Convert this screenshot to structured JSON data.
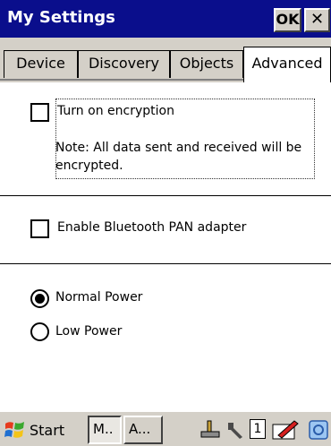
{
  "window": {
    "title": "My Settings",
    "ok_label": "OK",
    "close_label": "✕"
  },
  "tabs": [
    {
      "label": "Device",
      "active": false
    },
    {
      "label": "Discovery",
      "active": false
    },
    {
      "label": "Objects",
      "active": false
    },
    {
      "label": "Advanced",
      "active": true
    }
  ],
  "encryption": {
    "label": "Turn on encryption",
    "checked": false,
    "note": "Note: All data sent and received will be encrypted."
  },
  "pan_adapter": {
    "label": "Enable Bluetooth PAN adapter",
    "checked": false
  },
  "power": {
    "options": [
      {
        "label": "Normal Power",
        "selected": true
      },
      {
        "label": "Low Power",
        "selected": false
      }
    ]
  },
  "taskbar": {
    "start_label": "Start",
    "tasks": [
      "M..",
      "A..."
    ],
    "tray_number": "1",
    "icons": [
      "windows-flag-icon",
      "network-icon",
      "tools-icon",
      "input-panel-icon",
      "browser-icon"
    ],
    "colors": {
      "title_bar": "#0a0e8c",
      "chrome": "#d4d0c8"
    }
  }
}
